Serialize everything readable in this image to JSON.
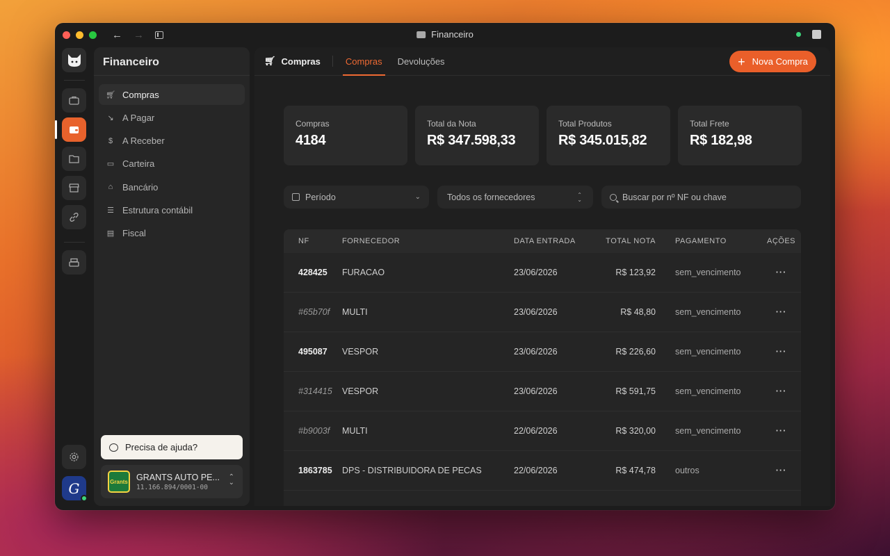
{
  "window": {
    "title": "Financeiro"
  },
  "sidebar": {
    "title": "Financeiro",
    "items": [
      {
        "label": "Compras",
        "icon": "cart-icon",
        "active": true
      },
      {
        "label": "A Pagar",
        "icon": "trend-down-icon",
        "active": false
      },
      {
        "label": "A Receber",
        "icon": "dollar-icon",
        "active": false
      },
      {
        "label": "Carteira",
        "icon": "wallet-icon",
        "active": false
      },
      {
        "label": "Bancário",
        "icon": "bank-icon",
        "active": false
      },
      {
        "label": "Estrutura contábil",
        "icon": "list-icon",
        "active": false
      },
      {
        "label": "Fiscal",
        "icon": "receipt-icon",
        "active": false
      }
    ],
    "help_label": "Precisa de ajuda?",
    "company": {
      "name": "GRANTS AUTO PE...",
      "id": "11.166.894/0001-00",
      "logo_text": "Grants"
    }
  },
  "header": {
    "breadcrumb": "Compras",
    "tabs": [
      {
        "label": "Compras",
        "active": true
      },
      {
        "label": "Devoluções",
        "active": false
      }
    ],
    "new_button": "Nova Compra"
  },
  "stats": [
    {
      "label": "Compras",
      "value": "4184"
    },
    {
      "label": "Total da Nota",
      "value": "R$ 347.598,33"
    },
    {
      "label": "Total Produtos",
      "value": "R$ 345.015,82"
    },
    {
      "label": "Total Frete",
      "value": "R$ 182,98"
    }
  ],
  "filters": {
    "period": "Período",
    "supplier": "Todos os fornecedores",
    "search_placeholder": "Buscar por nº NF ou chave"
  },
  "table": {
    "columns": [
      "NF",
      "FORNECEDOR",
      "DATA ENTRADA",
      "TOTAL NOTA",
      "PAGAMENTO",
      "AÇÕES"
    ],
    "rows": [
      {
        "nf": "428425",
        "fornecedor": "FURACAO",
        "data": "23/06/2026",
        "total": "R$ 123,92",
        "pagamento": "sem_vencimento",
        "acoes": "···",
        "draft": false
      },
      {
        "nf": "#65b70f",
        "fornecedor": "MULTI",
        "data": "23/06/2026",
        "total": "R$ 48,80",
        "pagamento": "sem_vencimento",
        "acoes": "···",
        "draft": true
      },
      {
        "nf": "495087",
        "fornecedor": "VESPOR",
        "data": "23/06/2026",
        "total": "R$ 226,60",
        "pagamento": "sem_vencimento",
        "acoes": "···",
        "draft": false
      },
      {
        "nf": "#314415",
        "fornecedor": "VESPOR",
        "data": "23/06/2026",
        "total": "R$ 591,75",
        "pagamento": "sem_vencimento",
        "acoes": "···",
        "draft": true
      },
      {
        "nf": "#b9003f",
        "fornecedor": "MULTI",
        "data": "22/06/2026",
        "total": "R$ 320,00",
        "pagamento": "sem_vencimento",
        "acoes": "···",
        "draft": true
      },
      {
        "nf": "1863785",
        "fornecedor": "DPS - DISTRIBUIDORA DE PECAS",
        "data": "22/06/2026",
        "total": "R$ 474,78",
        "pagamento": "outros",
        "acoes": "···",
        "draft": false
      },
      {
        "nf": "",
        "fornecedor": "",
        "data": "",
        "total": "",
        "pagamento": "",
        "acoes": "",
        "draft": false
      }
    ]
  },
  "colors": {
    "accent": "#ea5f2a",
    "background": "#1c1c1c",
    "panel": "#262626",
    "online": "#3dd37a"
  }
}
